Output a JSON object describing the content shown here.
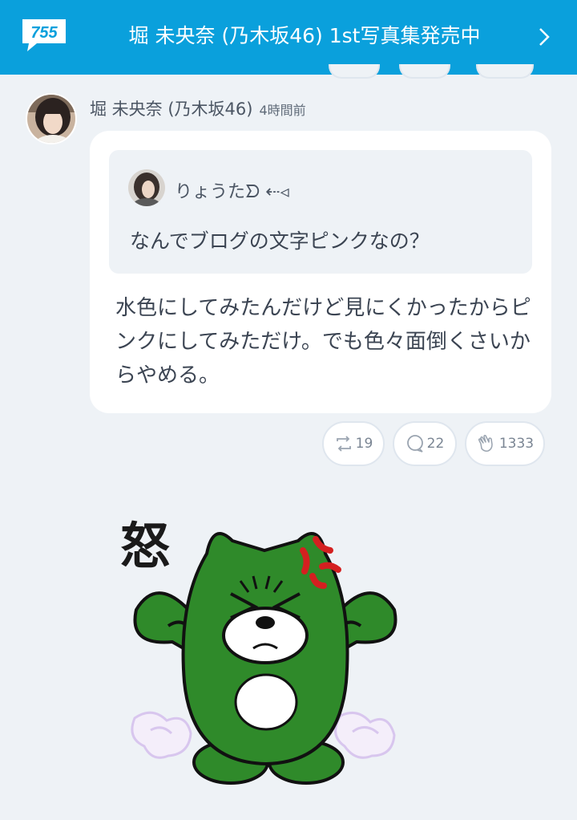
{
  "header": {
    "logo_text": "755",
    "title": "堀 未央奈 (乃木坂46) 1st写真集発売中",
    "chevron_icon": "chevron-right-icon"
  },
  "post": {
    "author": "堀 未央奈 (乃木坂46)",
    "time": "4時間前",
    "quote": {
      "name": "りょうたᗤ ⇠◃",
      "text": "なんでブログの文字ピンクなの？"
    },
    "reply_text": "水色にしてみたんだけど見にくかったからピンクにしてみただけ。でも色々面倒くさいからやめる。",
    "actions": {
      "repost_count": "19",
      "comment_count": "22",
      "clap_count": "1333"
    },
    "stamp": {
      "caption": "怒",
      "icon": "angry-green-character-sticker"
    }
  },
  "colors": {
    "header_bg": "#0aa0dc",
    "page_bg": "#eef2f6",
    "character_green": "#2f8a2a",
    "anger_red": "#d42020"
  }
}
